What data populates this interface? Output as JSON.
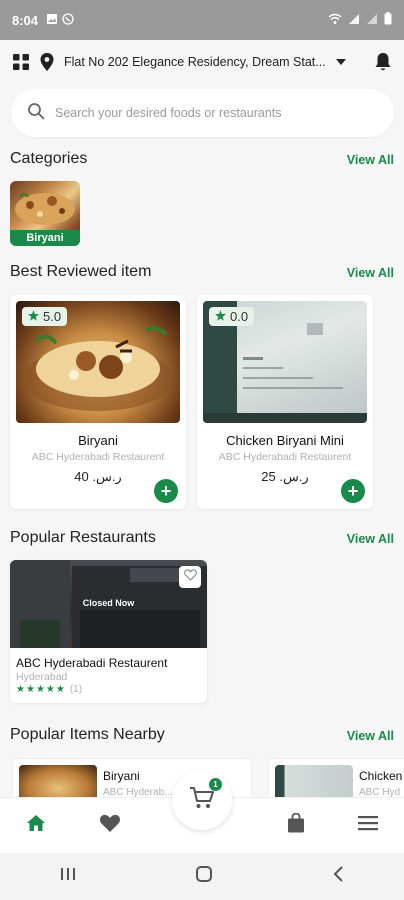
{
  "status_bar": {
    "time": "8:04"
  },
  "header": {
    "address": "Flat No 202 Elegance Residency, Dream Stat..."
  },
  "search": {
    "placeholder": "Search your desired foods or restaurants"
  },
  "categories": {
    "title": "Categories",
    "view_all": "View All",
    "items": [
      {
        "label": "Biryani"
      }
    ]
  },
  "best_reviewed": {
    "title": "Best Reviewed item",
    "view_all": "View All",
    "items": [
      {
        "rating": "5.0",
        "name": "Biryani",
        "restaurant": "ABC Hyderabadi Restaurent",
        "price": "40 .ر.س"
      },
      {
        "rating": "0.0",
        "name": "Chicken Biryani Mini",
        "restaurant": "ABC Hyderabadi Restaurent",
        "price": "25 .ر.س"
      }
    ]
  },
  "popular_restaurants": {
    "title": "Popular Restaurants",
    "view_all": "View All",
    "items": [
      {
        "status": "Closed Now",
        "name": "ABC Hyderabadi Restaurent",
        "location": "Hyderabad",
        "rating": 5,
        "review_count": "(1)"
      }
    ]
  },
  "popular_nearby": {
    "title": "Popular Items Nearby",
    "view_all": "View All",
    "items": [
      {
        "name": "Biryani",
        "restaurant": "ABC Hyderab..."
      },
      {
        "name": "Chicken",
        "restaurant": "ABC Hyd"
      }
    ]
  },
  "cart": {
    "count": "1"
  },
  "colors": {
    "accent": "#1a8a4a",
    "status_bar": "#9a9a9a"
  },
  "icons": {
    "header": [
      "grid-icon",
      "location-pin-icon",
      "dropdown-arrow-icon",
      "bell-icon"
    ],
    "bottom_nav": [
      "home-icon",
      "heart-icon",
      "cart-icon",
      "bag-icon",
      "menu-icon"
    ]
  }
}
